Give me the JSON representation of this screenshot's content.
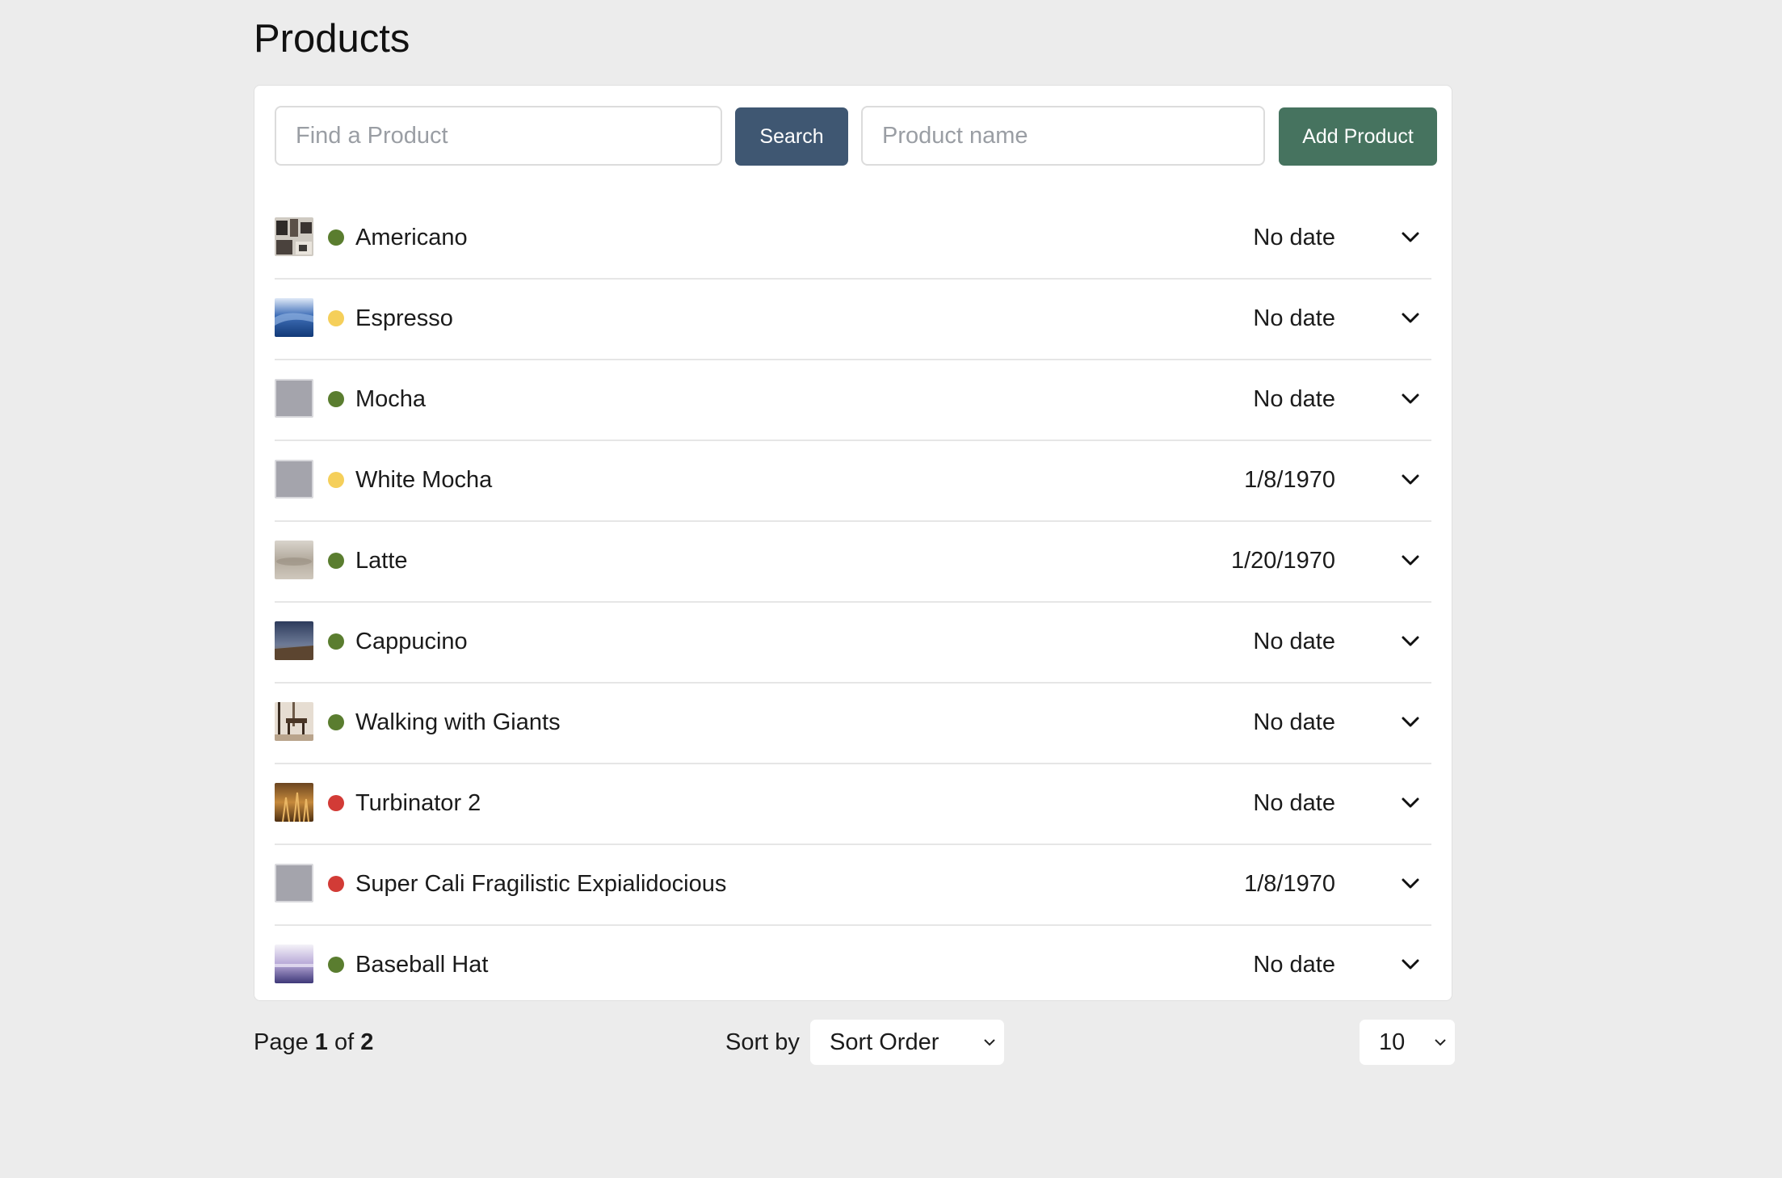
{
  "page": {
    "title": "Products"
  },
  "toolbar": {
    "find_placeholder": "Find a Product",
    "search_label": "Search",
    "name_placeholder": "Product name",
    "add_label": "Add Product"
  },
  "colors": {
    "status_active": "#5a7d2f",
    "status_pending": "#f5cf5a",
    "status_inactive": "#d23b36",
    "search_button": "#3f5772",
    "add_button": "#46735f"
  },
  "products": [
    {
      "name": "Americano",
      "date": "No date",
      "status": "active",
      "thumb": "photo-gallery"
    },
    {
      "name": "Espresso",
      "date": "No date",
      "status": "pending",
      "thumb": "photo-ocean"
    },
    {
      "name": "Mocha",
      "date": "No date",
      "status": "active",
      "thumb": "placeholder"
    },
    {
      "name": "White Mocha",
      "date": "1/8/1970",
      "status": "pending",
      "thumb": "placeholder"
    },
    {
      "name": "Latte",
      "date": "1/20/1970",
      "status": "active",
      "thumb": "photo-fog"
    },
    {
      "name": "Cappucino",
      "date": "No date",
      "status": "active",
      "thumb": "photo-dusk"
    },
    {
      "name": "Walking with Giants",
      "date": "No date",
      "status": "active",
      "thumb": "photo-room"
    },
    {
      "name": "Turbinator 2",
      "date": "No date",
      "status": "inactive",
      "thumb": "photo-field"
    },
    {
      "name": "Super Cali Fragilistic Expialidocious",
      "date": "1/8/1970",
      "status": "inactive",
      "thumb": "placeholder"
    },
    {
      "name": "Baseball Hat",
      "date": "No date",
      "status": "active",
      "thumb": "photo-sky"
    }
  ],
  "footer": {
    "page_prefix": "Page",
    "page_current": "1",
    "page_of": "of",
    "page_total": "2",
    "sort_label": "Sort by",
    "sort_value": "Sort Order",
    "page_size": "10"
  }
}
